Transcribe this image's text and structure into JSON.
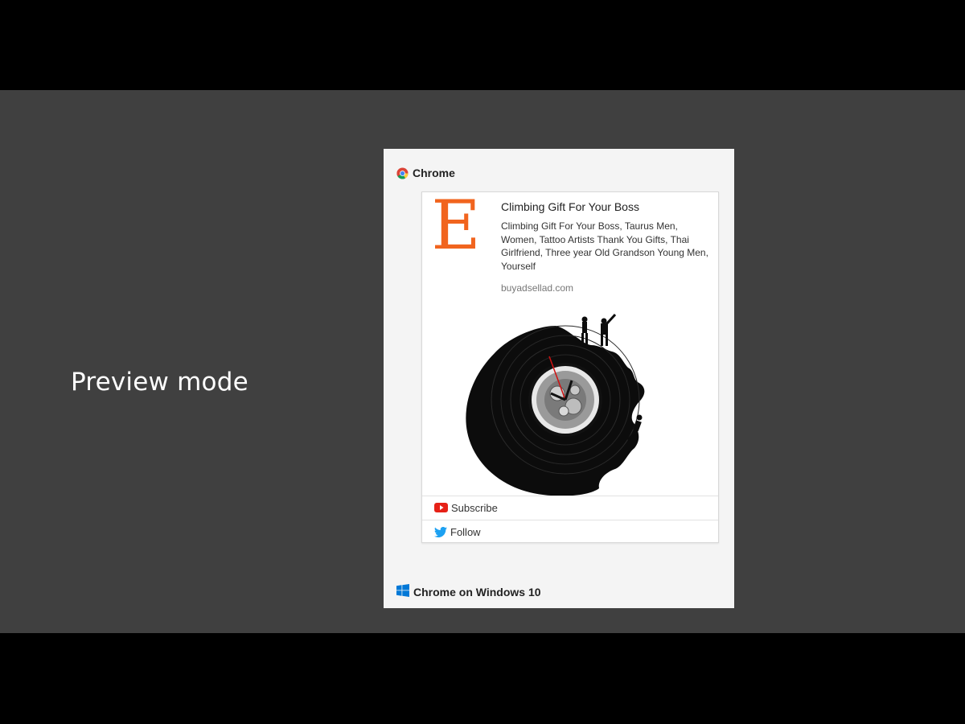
{
  "stage": {
    "label": "Preview mode"
  },
  "browser": {
    "name": "Chrome",
    "icon": "chrome-icon"
  },
  "notification": {
    "logo_letter": "E",
    "title": "Climbing Gift For Your Boss",
    "body": "Climbing Gift For Your Boss, Taurus Men, Women, Tattoo Artists Thank You Gifts, Thai Girlfriend, Three year Old Grandson Young Men, Yourself",
    "domain": "buyadsellad.com",
    "image": "vinyl-record-clock-climbers-image",
    "actions": [
      {
        "label": "Subscribe",
        "icon": "youtube-icon"
      },
      {
        "label": "Follow",
        "icon": "twitter-icon"
      }
    ]
  },
  "footer": {
    "label": "Chrome on Windows 10",
    "icon": "windows-icon"
  },
  "colors": {
    "brand": "#f1641e",
    "youtube": "#e62117",
    "twitter": "#1da1f2",
    "windows": "#0078d7"
  }
}
